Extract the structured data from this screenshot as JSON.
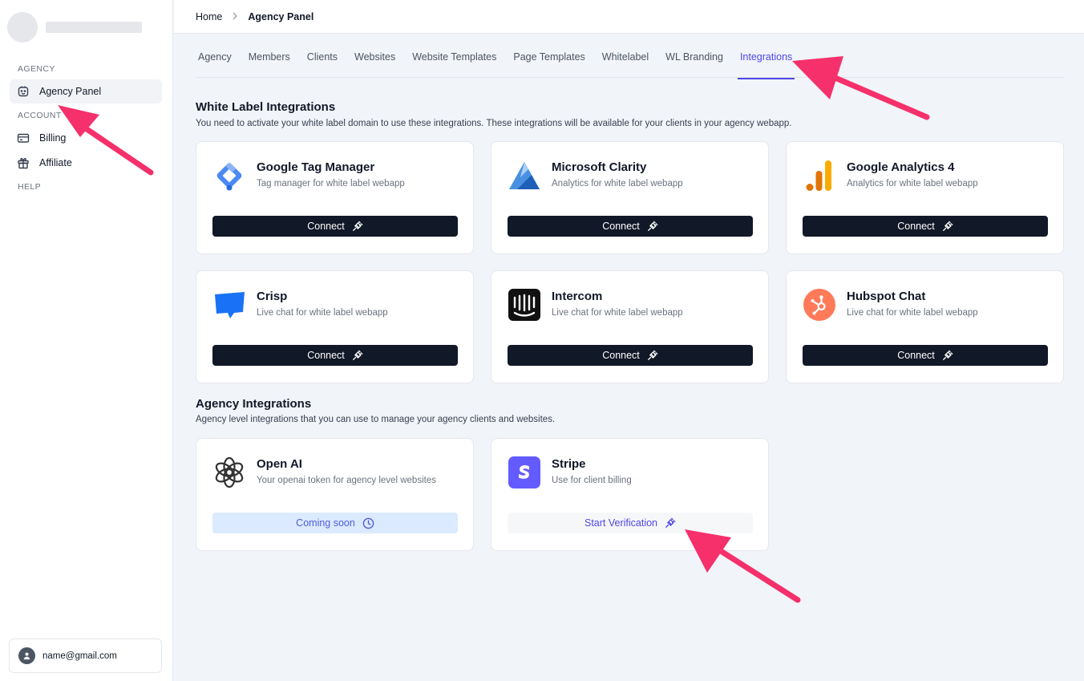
{
  "sidebar": {
    "sections": {
      "agency": "AGENCY",
      "account": "ACCOUNT",
      "help": "HELP"
    },
    "items": [
      {
        "label": "Agency Panel",
        "icon": "bot-icon",
        "active": true
      },
      {
        "label": "Billing",
        "icon": "credit-card-icon",
        "active": false
      },
      {
        "label": "Affiliate",
        "icon": "gift-icon",
        "active": false
      }
    ],
    "user_email": "name@gmail.com"
  },
  "breadcrumb": {
    "home": "Home",
    "current": "Agency Panel"
  },
  "tabs": [
    {
      "label": "Agency",
      "active": false
    },
    {
      "label": "Members",
      "active": false
    },
    {
      "label": "Clients",
      "active": false
    },
    {
      "label": "Websites",
      "active": false
    },
    {
      "label": "Website Templates",
      "active": false
    },
    {
      "label": "Page Templates",
      "active": false
    },
    {
      "label": "Whitelabel",
      "active": false
    },
    {
      "label": "WL Branding",
      "active": false
    },
    {
      "label": "Integrations",
      "active": true
    }
  ],
  "white_label": {
    "title": "White Label Integrations",
    "description": "You need to activate your white label domain to use these integrations. These integrations will be available for your clients in your agency webapp.",
    "cards": [
      {
        "title": "Google Tag Manager",
        "subtitle": "Tag manager for white label webapp",
        "button": "Connect",
        "icon": "google-tag-manager-icon"
      },
      {
        "title": "Microsoft Clarity",
        "subtitle": "Analytics for white label webapp",
        "button": "Connect",
        "icon": "microsoft-clarity-icon"
      },
      {
        "title": "Google Analytics 4",
        "subtitle": "Analytics for white label webapp",
        "button": "Connect",
        "icon": "google-analytics-icon"
      },
      {
        "title": "Crisp",
        "subtitle": "Live chat for white label webapp",
        "button": "Connect",
        "icon": "crisp-icon"
      },
      {
        "title": "Intercom",
        "subtitle": "Live chat for white label webapp",
        "button": "Connect",
        "icon": "intercom-icon"
      },
      {
        "title": "Hubspot Chat",
        "subtitle": "Live chat for white label webapp",
        "button": "Connect",
        "icon": "hubspot-icon"
      }
    ]
  },
  "agency": {
    "title": "Agency Integrations",
    "description": "Agency level integrations that you can use to manage your agency clients and websites.",
    "cards": [
      {
        "title": "Open AI",
        "subtitle": "Your openai token for agency level websites",
        "button": "Coming soon",
        "icon": "openai-icon"
      },
      {
        "title": "Stripe",
        "subtitle": "Use for client billing",
        "button": "Start Verification",
        "icon": "stripe-icon"
      }
    ]
  },
  "colors": {
    "accent": "#4f46e5",
    "dark_button": "#111827",
    "annotation_arrow": "#f5306b"
  }
}
